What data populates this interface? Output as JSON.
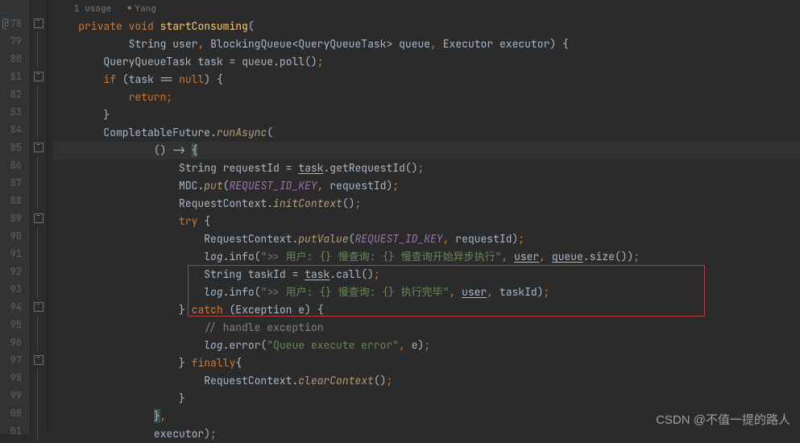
{
  "meta": {
    "usages_label": "1 usage",
    "author_label": "Yang"
  },
  "gutter": [
    "78",
    "79",
    "80",
    "81",
    "82",
    "83",
    "84",
    "85",
    "86",
    "87",
    "88",
    "89",
    "90",
    "91",
    "92",
    "93",
    "94",
    "95",
    "96",
    "97",
    "98",
    "99",
    "00",
    "01"
  ],
  "tokens": {
    "private": "private",
    "void": "void",
    "fn_startConsuming": "startConsuming",
    "String": "String",
    "user": "user",
    "BlockingQueue": "BlockingQueue",
    "QueryQueueTask": "QueryQueueTask",
    "queue": "queue",
    "Executor": "Executor",
    "executor": "executor",
    "task": "task",
    "poll": "poll",
    "if": "if",
    "null": "null",
    "return": "return",
    "CompletableFuture": "CompletableFuture",
    "runAsync": "runAsync",
    "requestId": "requestId",
    "getRequestId": "getRequestId",
    "MDC": "MDC",
    "put": "put",
    "REQUEST_ID_KEY": "REQUEST_ID_KEY",
    "RequestContext": "RequestContext",
    "initContext": "initContext",
    "try": "try",
    "putValue": "putValue",
    "log": "log",
    "info": "info",
    "str1": "\">> 用户: {} 慢查询: {} 慢查询开始异步执行\"",
    "size": "size",
    "taskId": "taskId",
    "call": "call",
    "str2": "\">> 用户: {} 慢查询: {} 执行完毕\"",
    "catch": "catch",
    "Exception": "Exception",
    "e": "e",
    "cmt_handle": "// handle exception",
    "error": "error",
    "str_err": "\"Queue execute error\"",
    "finally": "finally",
    "clearContext": "clearContext"
  },
  "watermark": "CSDN @不值一提的路人"
}
